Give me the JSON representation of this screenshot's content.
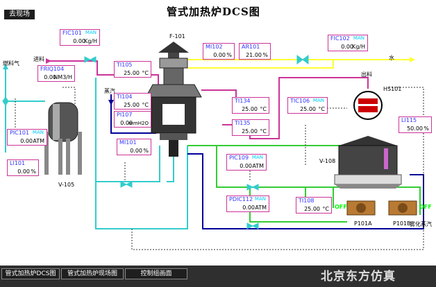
{
  "header": {
    "back_button": "去现场",
    "title": "管式加热炉DCS图"
  },
  "labels": {
    "furnace": "F-101",
    "feed_in": "进料",
    "fuel_gas": "燃料气",
    "water": "水",
    "discharge": "出料",
    "steam": "蒸汽",
    "vessel_left": "V-105",
    "vessel_right": "V-108",
    "heat_exchanger": "HS101",
    "pump_a": "P101A",
    "pump_b": "P101B",
    "atomizing_steam": "雾化蒸汽",
    "off_a": "OFF",
    "off_b": "OFF"
  },
  "tags": {
    "fic101_top": {
      "name": "FIC101",
      "mode": "MAN",
      "value": "0.00",
      "unit": "Kg/H"
    },
    "frq104": {
      "name": "FRIQ104",
      "mode": "",
      "value": "0.00",
      "unit": "NM3/H"
    },
    "pic101": {
      "name": "PIC101",
      "mode": "MAN",
      "value": "0.00",
      "unit": "ATM"
    },
    "li101": {
      "name": "LI101",
      "mode": "",
      "value": "0.00",
      "unit": "%"
    },
    "ti105": {
      "name": "TI105",
      "mode": "",
      "value": "25.00",
      "unit": "°C"
    },
    "ti104": {
      "name": "TI104",
      "mode": "",
      "value": "25.00",
      "unit": "°C"
    },
    "pi107": {
      "name": "PI107",
      "mode": "",
      "value": "0.00",
      "unit": "mmH2O"
    },
    "mi101": {
      "name": "MI101",
      "mode": "",
      "value": "0.00",
      "unit": "%"
    },
    "mi102": {
      "name": "MI102",
      "mode": "",
      "value": "0.00",
      "unit": "%"
    },
    "ar101": {
      "name": "AR101",
      "mode": "",
      "value": "21.00",
      "unit": "%"
    },
    "fic102": {
      "name": "FIC102",
      "mode": "MAN",
      "value": "0.00",
      "unit": "Kg/H"
    },
    "ti134": {
      "name": "TI134",
      "mode": "",
      "value": "25.00",
      "unit": "°C"
    },
    "ti135": {
      "name": "TI135",
      "mode": "",
      "value": "25.00",
      "unit": "°C"
    },
    "tic106": {
      "name": "TIC106",
      "mode": "MAN",
      "value": "25.00",
      "unit": "°C"
    },
    "li115": {
      "name": "LI115",
      "mode": "",
      "value": "50.00",
      "unit": "%"
    },
    "pic109": {
      "name": "PIC109",
      "mode": "MAN",
      "value": "0.00",
      "unit": "ATM"
    },
    "pdic112": {
      "name": "PDIC112",
      "mode": "MAN",
      "value": "0.00",
      "unit": "ATM"
    },
    "ti108": {
      "name": "TI108",
      "mode": "",
      "value": "25.00",
      "unit": "°C"
    }
  },
  "footer": {
    "tabs": [
      "管式加热炉DCS图",
      "管式加热炉现场图",
      "控制组画面"
    ],
    "brand": "北京东方仿真"
  },
  "colors": {
    "pipe_pink": "#cc3399",
    "pipe_cyan": "#33cccc",
    "pipe_yellow": "#ffff33",
    "pipe_green": "#33cc33",
    "pipe_blue": "#000099",
    "tag_border": "#cc3399",
    "man": "#00ccff"
  }
}
